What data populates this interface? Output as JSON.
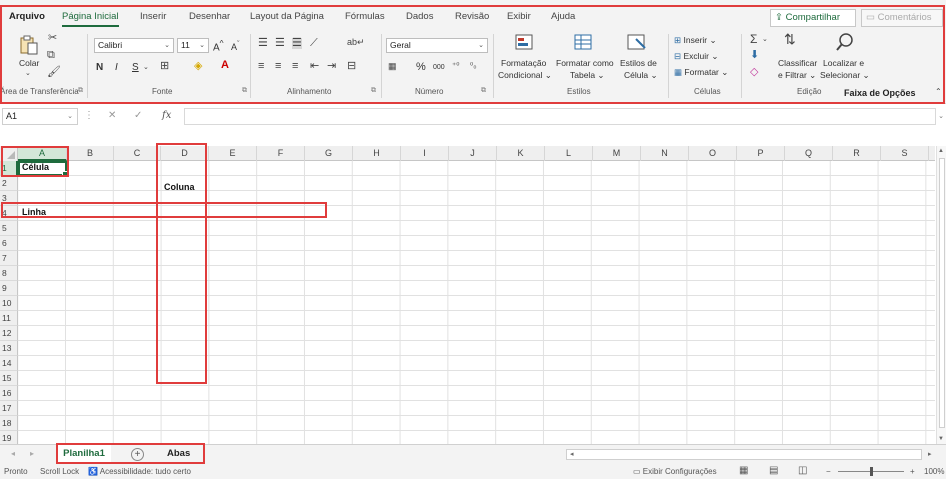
{
  "ribbon": {
    "tabs": [
      {
        "label": "Arquivo",
        "bold": true
      },
      {
        "label": "Página Inicial",
        "active": true
      },
      {
        "label": "Inserir"
      },
      {
        "label": "Desenhar"
      },
      {
        "label": "Layout da Página"
      },
      {
        "label": "Fórmulas"
      },
      {
        "label": "Dados"
      },
      {
        "label": "Revisão"
      },
      {
        "label": "Exibir"
      },
      {
        "label": "Ajuda"
      }
    ],
    "share_label": "Compartilhar",
    "comments_label": "Comentários",
    "clipboard": {
      "paste_label": "Colar",
      "group_label": "Área de Transferência"
    },
    "font": {
      "name": "Calibri",
      "size": "11",
      "grow": "A",
      "shrink": "A",
      "bold": "N",
      "italic": "I",
      "underline": "S",
      "group_label": "Fonte"
    },
    "alignment": {
      "group_label": "Alinhamento"
    },
    "number": {
      "format": "Geral",
      "percent": "%",
      "thousands": "000",
      "group_label": "Número"
    },
    "styles": {
      "conditional_label_1": "Formatação",
      "conditional_label_2": "Condicional",
      "table_label_1": "Formatar como",
      "table_label_2": "Tabela",
      "cell_styles_label_1": "Estilos de",
      "cell_styles_label_2": "Célula",
      "group_label": "Estilos"
    },
    "cells": {
      "insert": "Inserir",
      "delete": "Excluir",
      "format": "Formatar",
      "group_label": "Células"
    },
    "editing": {
      "sort_label_1": "Classificar",
      "sort_label_2": "e Filtrar",
      "find_label_1": "Localizar e",
      "find_label_2": "Selecionar",
      "group_label": "Edição"
    },
    "annotation": "Faixa de Opções"
  },
  "formula_bar": {
    "name_box": "A1",
    "fx": "fx",
    "cancel": "✕",
    "enter": "✓",
    "value": ""
  },
  "grid": {
    "columns": [
      "A",
      "B",
      "C",
      "D",
      "E",
      "F",
      "G",
      "H",
      "I",
      "J",
      "K",
      "L",
      "M",
      "N",
      "O",
      "P",
      "Q",
      "R",
      "S"
    ],
    "rows": [
      "1",
      "2",
      "3",
      "4",
      "5",
      "6",
      "7",
      "8",
      "9",
      "10",
      "11",
      "12",
      "13",
      "14",
      "15",
      "16",
      "17",
      "18",
      "19"
    ],
    "selected_column": "A",
    "selected_row": "1",
    "cells": {
      "A1": "Célula",
      "D2": "Coluna",
      "A4": "Linha"
    }
  },
  "sheets": {
    "tabs": [
      "Planilha1"
    ],
    "add": "+",
    "annotation": "Abas"
  },
  "status": {
    "ready": "Pronto",
    "scroll_lock": "Scroll Lock",
    "accessibility": "Acessibilidade: tudo certo",
    "display_settings": "Exibir Configurações",
    "zoom_out": "−",
    "zoom_in": "+",
    "zoom": "100%"
  },
  "colors": {
    "accent": "#1e6b3d",
    "annotation": "#e03c3c"
  }
}
